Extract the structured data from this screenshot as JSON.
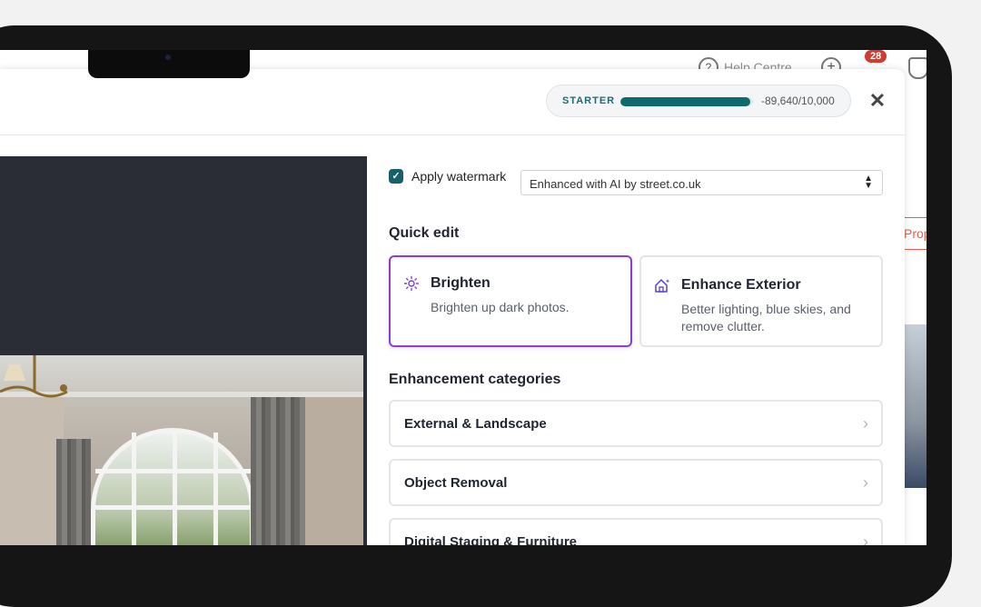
{
  "background_app": {
    "help_label": "Help Centre",
    "notification_count": "28",
    "side_button_label": "Prop"
  },
  "modal": {
    "plan": "STARTER",
    "credits_text": "-89,640/10,000",
    "credits_fill_fraction": 0.98,
    "close_symbol": "✕"
  },
  "watermark": {
    "label": "Apply watermark",
    "checked": true,
    "selected_option": "Enhanced with AI by street.co.uk"
  },
  "quick_edit": {
    "title": "Quick edit",
    "cards": [
      {
        "title": "Brighten",
        "desc": "Brighten up dark photos.",
        "icon": "sun-icon",
        "selected": true
      },
      {
        "title": "Enhance Exterior",
        "desc": "Better lighting, blue skies, and remove clutter.",
        "icon": "house-sparkle-icon",
        "selected": false
      }
    ]
  },
  "categories": {
    "title": "Enhancement categories",
    "items": [
      {
        "label": "External & Landscape"
      },
      {
        "label": "Object Removal"
      },
      {
        "label": "Digital Staging & Furniture"
      }
    ]
  },
  "colors": {
    "accent_teal": "#16606a",
    "selected_purple": "#8b3fd1",
    "badge_red": "#d23b2f"
  }
}
